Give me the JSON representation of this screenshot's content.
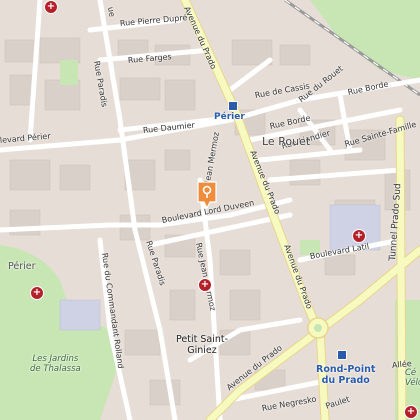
{
  "map": {
    "streets": {
      "rue_pierre_dupre": "Rue Pierre Dupré",
      "rue_farges": "Rue Farges",
      "rue_paradis_top": "Rue Paradis",
      "rue_paradis_bottom": "Rue Paradis",
      "avenue_du_prado_top": "Avenue du Prado",
      "avenue_du_prado_mid": "Avenue du Prado",
      "avenue_du_prado_lower": "Avenue du Prado",
      "avenue_du_prado_bottom": "Avenue du Prado",
      "rue_de_cassis": "Rue de Cassis",
      "rue_du_rouet": "Rue du Rouet",
      "rue_borde_top": "Rue Borde",
      "rue_borde": "Rue Borde",
      "rue_liandier": "Rue Liandier",
      "rue_sainte_famille": "Rue Sainte-Famille",
      "rue_daumier": "Rue Daumier",
      "boulevard_perier": "levard Périer",
      "rue_jean_mermoz_top": "Jean Mermoz",
      "rue_jean_mermoz_bottom": "Rue Jean Mermoz",
      "boulevard_lord_duveen": "Boulevard Lord Duveen",
      "boulevard_latil": "Boulevard Latil",
      "rue_commandant_rolland": "Rue du Commandant Rolland",
      "tunnel_prado_sud": "Tunnel Prado Sud",
      "rue_negresko": "Rue Negresko",
      "paulet": "Paulet",
      "alle": "Allée",
      "rue_fragment_top": "ue"
    },
    "areas": {
      "perier_district": "Périer",
      "le_rouet": "Le Rouet",
      "petit_saint_giniez": "Petit Saint-\nGiniez",
      "rond_point_du_prado": "Rond-Point\ndu Prado",
      "jardins_de_thalassa": "Les Jardins\nde Thalassa",
      "velodrome_fragment": "Cé\nVélo"
    },
    "metro": {
      "perier_station": "Périer",
      "rond_point_station": "Rond-Point du Prado"
    },
    "markers": {
      "selected_pin_icon": "map-pin-icon",
      "hospital_icon": "hospital-cross-icon"
    },
    "colors": {
      "background": "#f2efe9",
      "building": "#d9d0c9",
      "major_road": "#f7fabf",
      "minor_road": "#ffffff",
      "park": "#c8e6b4",
      "pin": "#ef8d3c",
      "poi": "#b3202a",
      "metro": "#2b5cab",
      "rail": "#9a9a9a"
    }
  }
}
